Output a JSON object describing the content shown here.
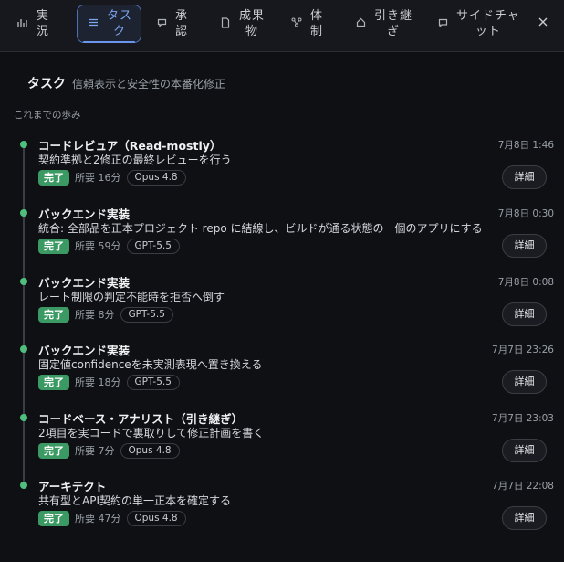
{
  "tabs": [
    {
      "label": "実\n況",
      "icon": "chart-bars-icon"
    },
    {
      "label": "タス\nク",
      "icon": "list-icon"
    },
    {
      "label": "承\n認",
      "icon": "chat-bubble-icon"
    },
    {
      "label": "成果\n物",
      "icon": "document-icon"
    },
    {
      "label": "体\n制",
      "icon": "org-chart-icon"
    },
    {
      "label": "引き継\nぎ",
      "icon": "home-icon"
    },
    {
      "label": "サイドチャ\nット",
      "icon": "comment-icon"
    }
  ],
  "panel": {
    "title": "タスク",
    "subtitle": "信頼表示と安全性の本番化修正",
    "section_label": "これまでの歩み"
  },
  "items": [
    {
      "title": "コードレビュア（Read-mostly）",
      "time": "7月8日 1:46",
      "desc": "契約準拠と2修正の最終レビューを行う",
      "status": "完了",
      "duration": "所要 16分",
      "model": "Opus 4.8",
      "detail": "詳細"
    },
    {
      "title": "バックエンド実装",
      "time": "7月8日 0:30",
      "desc": "統合: 全部品を正本プロジェクト repo に結線し、ビルドが通る状態の一個のアプリにする",
      "status": "完了",
      "duration": "所要 59分",
      "model": "GPT-5.5",
      "detail": "詳細"
    },
    {
      "title": "バックエンド実装",
      "time": "7月8日 0:08",
      "desc": "レート制限の判定不能時を拒否へ倒す",
      "status": "完了",
      "duration": "所要 8分",
      "model": "GPT-5.5",
      "detail": "詳細"
    },
    {
      "title": "バックエンド実装",
      "time": "7月7日 23:26",
      "desc": "固定値confidenceを未実測表現へ置き換える",
      "status": "完了",
      "duration": "所要 18分",
      "model": "GPT-5.5",
      "detail": "詳細"
    },
    {
      "title": "コードベース・アナリスト（引き継ぎ）",
      "time": "7月7日 23:03",
      "desc": "2項目を実コードで裏取りして修正計画を書く",
      "status": "完了",
      "duration": "所要 7分",
      "model": "Opus 4.8",
      "detail": "詳細"
    },
    {
      "title": "アーキテクト",
      "time": "7月7日 22:08",
      "desc": "共有型とAPI契約の単一正本を確定する",
      "status": "完了",
      "duration": "所要 47分",
      "model": "Opus 4.8",
      "detail": "詳細"
    }
  ],
  "colors": {
    "accent": "#6b96ec",
    "success": "#3b9a63",
    "background": "#0e1014"
  }
}
